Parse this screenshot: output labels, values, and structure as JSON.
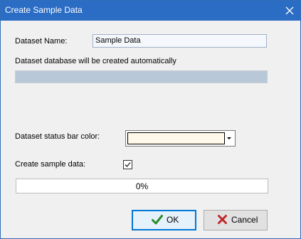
{
  "window": {
    "title": "Create Sample Data",
    "close_glyph": "close-icon"
  },
  "form": {
    "dataset_name_label": "Dataset Name:",
    "dataset_name_value": "Sample Data",
    "dataset_db_note": "Dataset database will be created automatically",
    "status_color_label": "Dataset status bar color:",
    "status_color_value": "#fff8ea",
    "create_sample_label": "Create sample data:",
    "create_sample_checked": true
  },
  "progress": {
    "value": 0,
    "text": "0%"
  },
  "buttons": {
    "ok_label": "OK",
    "ok_icon": "checkmark-icon",
    "cancel_label": "Cancel",
    "cancel_icon": "x-icon"
  },
  "colors": {
    "titlebar": "#2b6cc4",
    "ok_check": "#2e8b2e",
    "cancel_x": "#c0282a",
    "db_box": "#b9c8d9"
  }
}
